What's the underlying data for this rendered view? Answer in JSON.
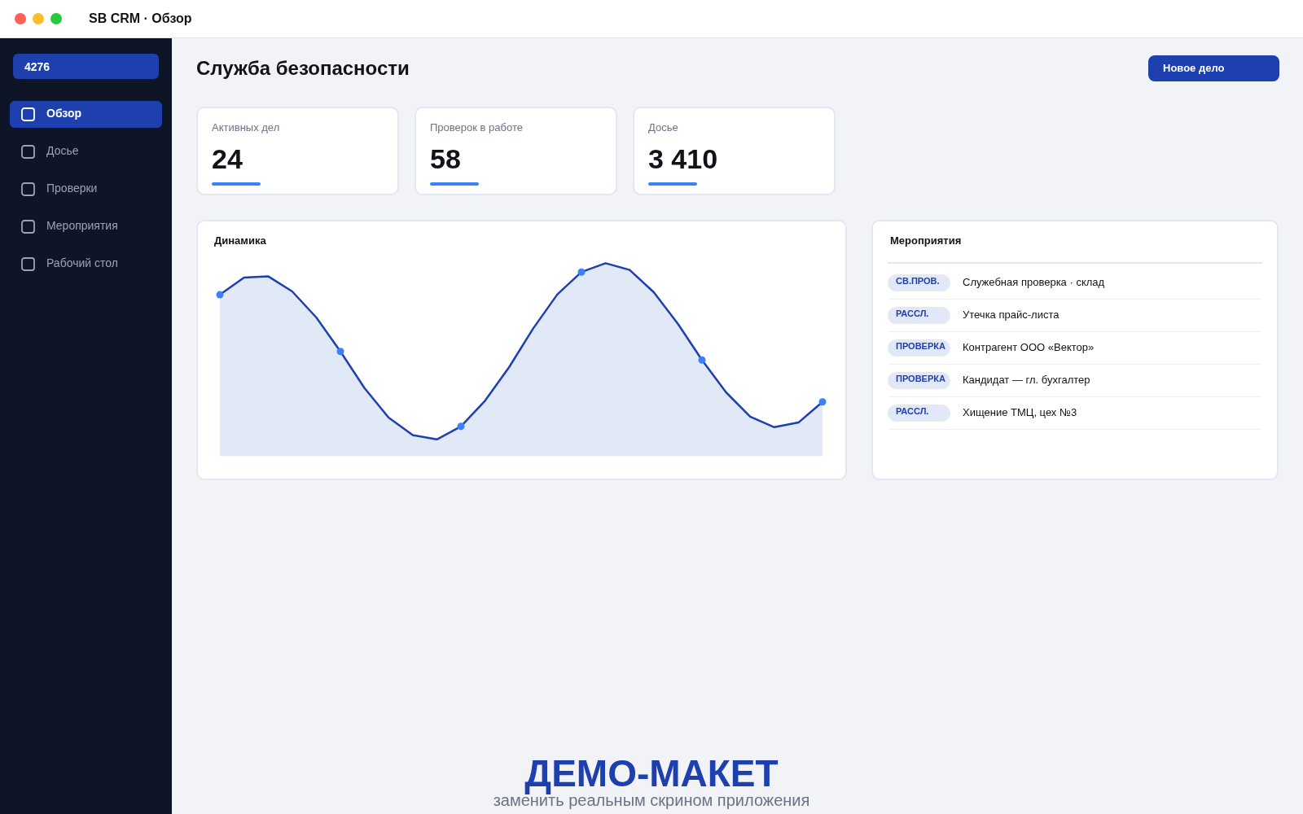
{
  "window": {
    "title": "SB CRM · Обзор"
  },
  "sidebar": {
    "badge": "4276",
    "items": [
      {
        "label": "Обзор",
        "selected": true
      },
      {
        "label": "Досье",
        "selected": false
      },
      {
        "label": "Проверки",
        "selected": false
      },
      {
        "label": "Мероприятия",
        "selected": false
      },
      {
        "label": "Рабочий стол",
        "selected": false
      }
    ]
  },
  "header": {
    "title": "Служба безопасности",
    "button": "Новое дело"
  },
  "stats": [
    {
      "label": "Активных дел",
      "value": "24"
    },
    {
      "label": "Проверок в работе",
      "value": "58"
    },
    {
      "label": "Досье",
      "value": "3 410"
    }
  ],
  "chart_panel": {
    "title": "Динамика"
  },
  "events": {
    "title": "Мероприятия",
    "rows": [
      {
        "tag": "СВ.ПРОВ.",
        "text": "Служебная проверка · склад"
      },
      {
        "tag": "РАССЛ.",
        "text": "Утечка прайс-листа"
      },
      {
        "tag": "ПРОВЕРКА",
        "text": "Контрагент ООО «Вектор»"
      },
      {
        "tag": "ПРОВЕРКА",
        "text": "Кандидат — гл. бухгалтер"
      },
      {
        "tag": "РАССЛ.",
        "text": "Хищение ТМЦ, цех №3"
      }
    ]
  },
  "demo_label": {
    "title": "ДЕМО-МАКЕТ",
    "subtitle": "заменить реальным скрином приложения"
  }
}
